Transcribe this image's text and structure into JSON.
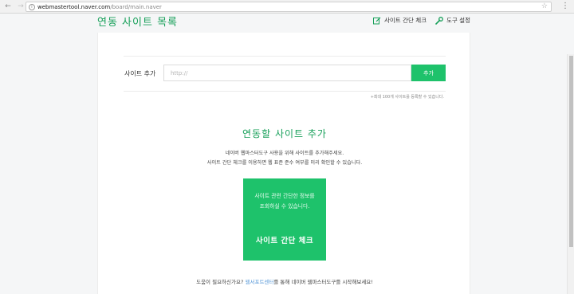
{
  "browser": {
    "url_host": "webmastertool.naver.com",
    "url_path": "/board/main.naver"
  },
  "header": {
    "title": "연동 사이트 목록",
    "check_link": "사이트 간단 체크",
    "tools_link": "도구 설정"
  },
  "add_site": {
    "label": "사이트 추가",
    "placeholder": "http://",
    "button": "추가",
    "note": "+최대 100개 사이트를 등록할 수 있습니다."
  },
  "empty_state": {
    "title": "연동할 사이트 추가",
    "desc_line1": "네이버 웹마스터도구 사용을 위해 사이트를 추가해주세요.",
    "desc_line2": "사이트 간단 체크를 이용하면 웹 표준 준수 여부를 미리 확인할 수 있습니다."
  },
  "check_tile": {
    "desc_line1": "사이트 관련 간단한 정보를",
    "desc_line2": "조회하실 수 있습니다.",
    "title": "사이트 간단 체크"
  },
  "help": {
    "prefix": "도움이 필요하신가요? ",
    "link": "웹서포트센터",
    "suffix": "를 통해 네이버 웹마스터도구를 시작해보세요!"
  },
  "colors": {
    "accent": "#1ec26b",
    "title_green": "#18a05a",
    "link_blue": "#5a9ad8"
  }
}
